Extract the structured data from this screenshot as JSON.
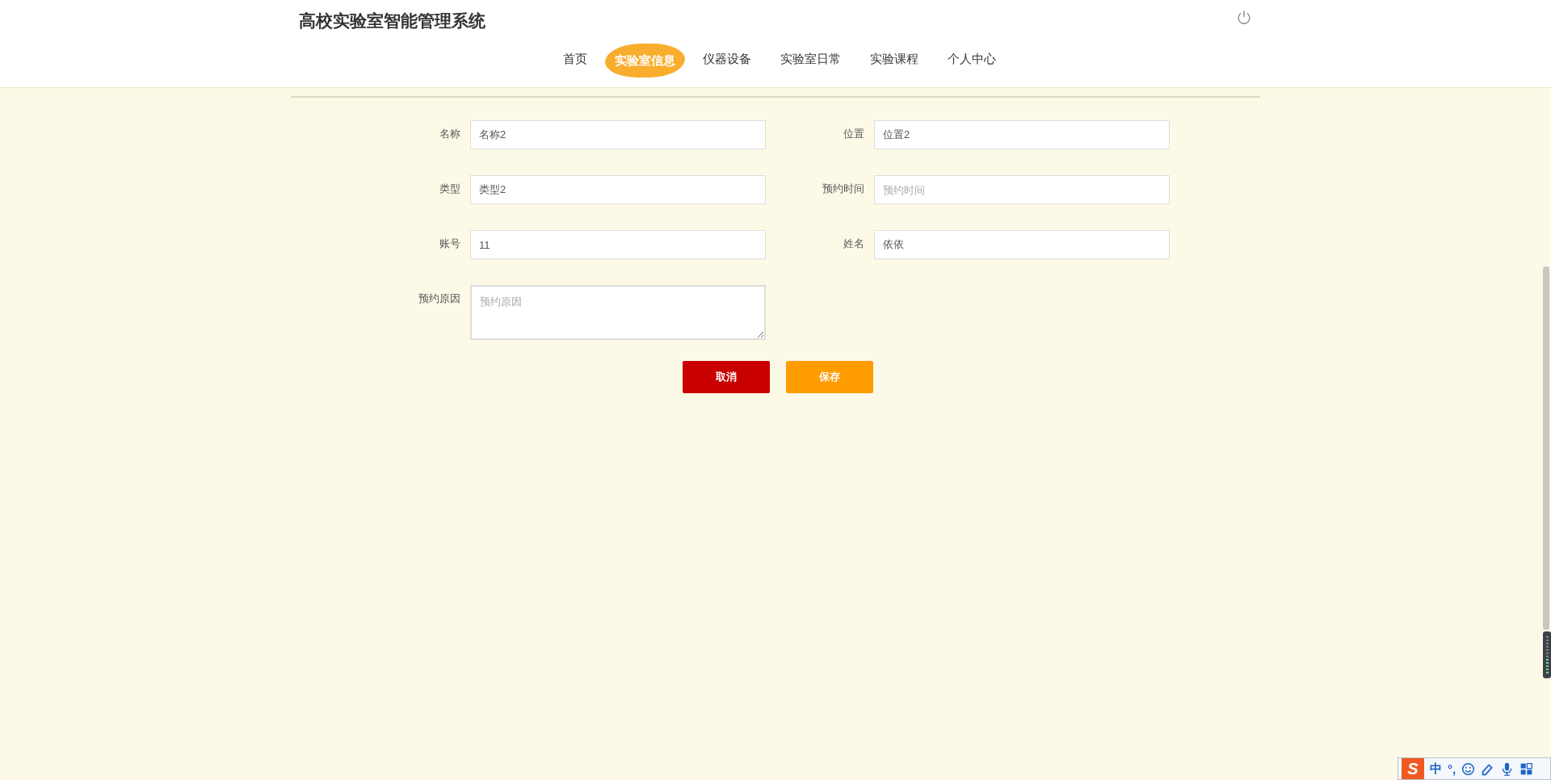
{
  "header": {
    "title": "高校实验室智能管理系统"
  },
  "nav": [
    {
      "label": "首页",
      "selected": false
    },
    {
      "label": "实验室信息",
      "selected": true
    },
    {
      "label": "仪器设备",
      "selected": false
    },
    {
      "label": "实验室日常",
      "selected": false
    },
    {
      "label": "实验课程",
      "selected": false
    },
    {
      "label": "个人中心",
      "selected": false
    }
  ],
  "form": {
    "fields": [
      {
        "label": "名称",
        "kind": "input",
        "value": "名称2"
      },
      {
        "label": "位置",
        "kind": "input",
        "value": "位置2"
      },
      {
        "label": "类型",
        "kind": "input",
        "value": "类型2"
      },
      {
        "label": "预约时间",
        "kind": "input",
        "placeholder": "预约时间"
      },
      {
        "label": "账号",
        "kind": "input",
        "value": "11"
      },
      {
        "label": "姓名",
        "kind": "input",
        "value": "依依"
      },
      {
        "label": "预约原因",
        "kind": "textarea",
        "placeholder": "预约原因"
      }
    ],
    "buttons": [
      {
        "label": "取消",
        "kind": "cancel"
      },
      {
        "label": "保存",
        "kind": "save"
      }
    ]
  },
  "ime_bar": {
    "logo": "S",
    "items": [
      {
        "kind": "text",
        "label": "中"
      },
      {
        "kind": "text",
        "label": "°,"
      },
      {
        "kind": "smiley"
      },
      {
        "kind": "pen"
      },
      {
        "kind": "mic"
      },
      {
        "kind": "grid"
      }
    ]
  }
}
